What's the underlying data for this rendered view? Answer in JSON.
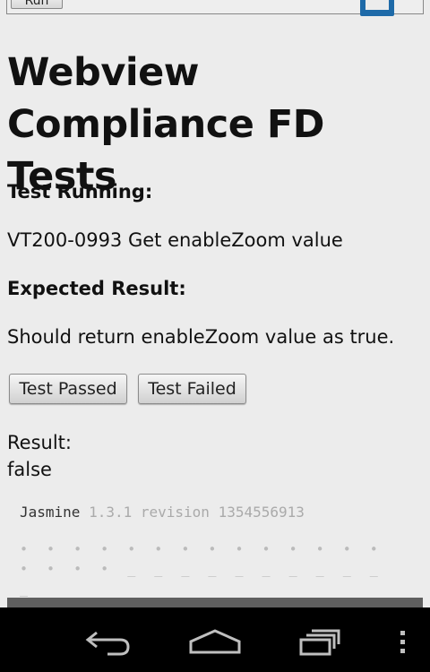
{
  "header": {
    "run_label": "Run"
  },
  "page": {
    "title": "Webview Compliance FD Tests",
    "test_running_label": "Test Running:",
    "test_name": "VT200-0993 Get enableZoom value",
    "expected_result_label": "Expected Result:",
    "expected_result": "Should return enableZoom value as true.",
    "buttons": {
      "passed": "Test Passed",
      "failed": "Test Failed"
    },
    "result_label": "Result:",
    "result_value": "false"
  },
  "jasmine": {
    "name": "Jasmine",
    "version": "1.3.1 revision 1354556913",
    "progress": "• • • • • • • • • • • • • • • • • • _ _ _ _ _ _ _ _ _ _ _"
  },
  "navbar": {
    "icons": [
      "back-icon",
      "home-icon",
      "recent-apps-icon",
      "overflow-menu-icon"
    ]
  }
}
